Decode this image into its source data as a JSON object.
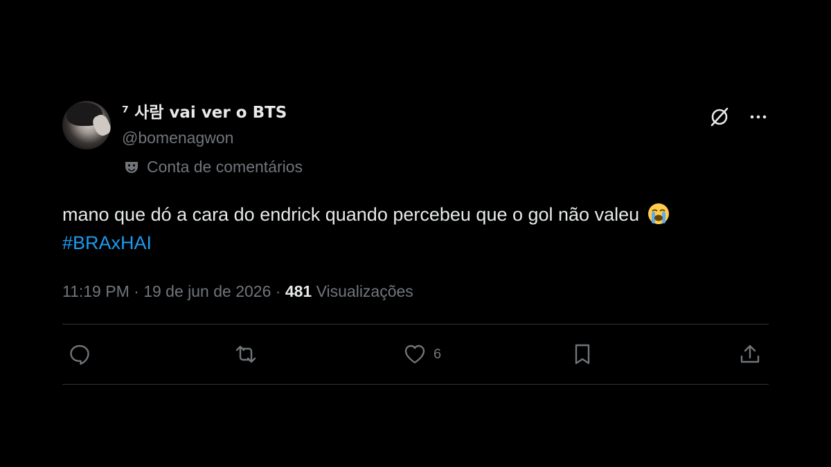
{
  "author": {
    "display_name": "⁷ 사람 vai ver o BTS",
    "handle": "@bomenagwon",
    "parody_label": "Conta de comentários"
  },
  "tweet": {
    "text": "mano que dó a cara do endrick quando percebeu que o gol não valeu",
    "emoji": "loudly-crying-face",
    "hashtag": "#BRAxHAI",
    "time": "11:19 PM",
    "separator": "·",
    "date": "19 de jun de 2026",
    "views_count": "481",
    "views_label": "Visualizações"
  },
  "actions": {
    "reply_count": "",
    "retweet_count": "",
    "like_count": "6"
  },
  "icons": {
    "grok": "grok-icon",
    "more": "more-icon",
    "parody": "theater-mask-icon",
    "reply": "reply-icon",
    "retweet": "retweet-icon",
    "like": "heart-icon",
    "bookmark": "bookmark-icon",
    "share": "share-icon"
  },
  "colors": {
    "background": "#000000",
    "text_primary": "#e7e9ea",
    "text_secondary": "#71767b",
    "accent": "#1d9bf0",
    "divider": "#2f3336"
  }
}
